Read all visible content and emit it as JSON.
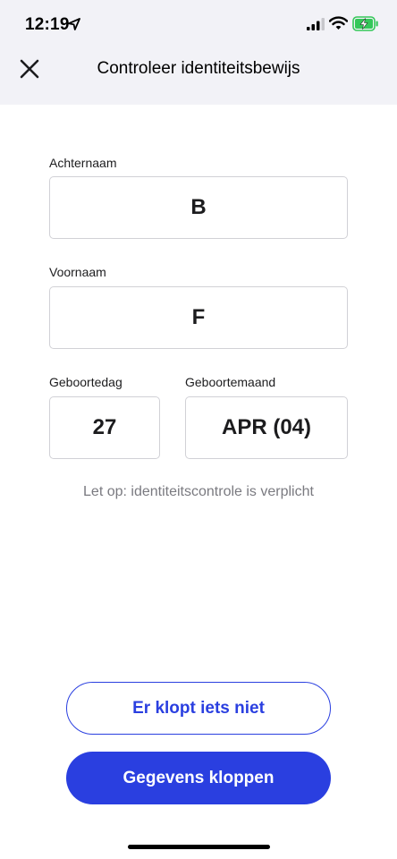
{
  "status_bar": {
    "time": "12:19",
    "icons": [
      "location-arrow-icon",
      "cellular-signal-icon",
      "wifi-icon",
      "battery-charging-icon"
    ]
  },
  "header": {
    "title": "Controleer identiteitsbewijs",
    "close_icon": "close-icon"
  },
  "form": {
    "last_name": {
      "label": "Achternaam",
      "value": "B"
    },
    "first_name": {
      "label": "Voornaam",
      "value": "F"
    },
    "birth_day": {
      "label": "Geboortedag",
      "value": "27"
    },
    "birth_month": {
      "label": "Geboortemaand",
      "value": "APR (04)"
    }
  },
  "notice": "Let op: identiteitscontrole is verplicht",
  "actions": {
    "incorrect_label": "Er klopt iets niet",
    "confirm_label": "Gegevens kloppen"
  },
  "colors": {
    "accent": "#2a3fe0",
    "header_bg": "#f2f2f7",
    "field_border": "#d1d1d6",
    "battery_green": "#34c759"
  }
}
